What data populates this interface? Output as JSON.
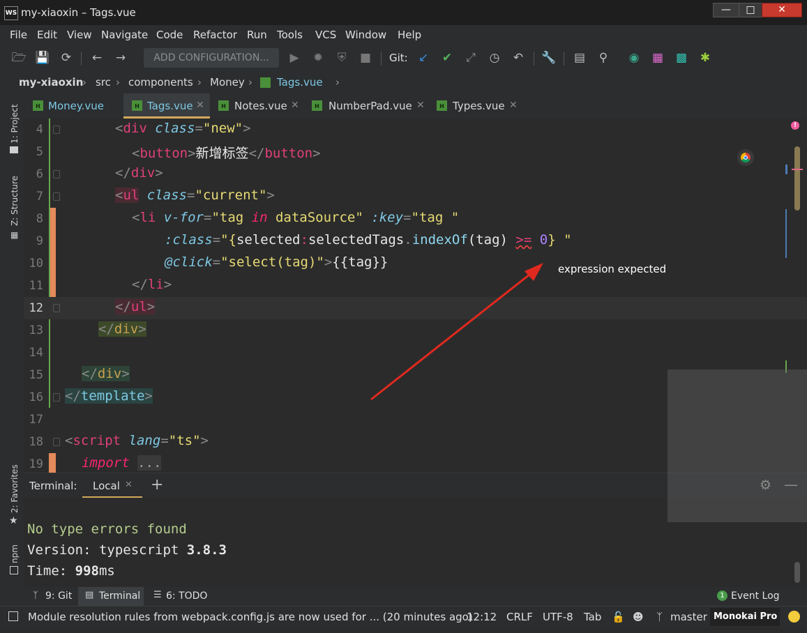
{
  "window": {
    "title": "my-xiaoxin – Tags.vue",
    "app_icon": "WS"
  },
  "menu": [
    "File",
    "Edit",
    "View",
    "Navigate",
    "Code",
    "Refactor",
    "Run",
    "Tools",
    "VCS",
    "Window",
    "Help"
  ],
  "toolbar": {
    "config_label": "ADD CONFIGURATION...",
    "git_label": "Git:"
  },
  "breadcrumb": [
    "my-xiaoxin",
    "src",
    "components",
    "Money",
    "Tags.vue"
  ],
  "left_tools": {
    "project": "1: Project",
    "structure": "Z: Structure",
    "favorites": "2: Favorites",
    "npm": "npm"
  },
  "tabs": [
    {
      "label": "Money.vue"
    },
    {
      "label": "Tags.vue"
    },
    {
      "label": "Notes.vue"
    },
    {
      "label": "NumberPad.vue"
    },
    {
      "label": "Types.vue"
    }
  ],
  "editor": {
    "lines": [
      {
        "num": "4"
      },
      {
        "num": "5"
      },
      {
        "num": "6"
      },
      {
        "num": "7"
      },
      {
        "num": "8"
      },
      {
        "num": "9"
      },
      {
        "num": "10"
      },
      {
        "num": "11"
      },
      {
        "num": "12"
      },
      {
        "num": "13"
      },
      {
        "num": "14"
      },
      {
        "num": "15"
      },
      {
        "num": "16"
      },
      {
        "num": "17"
      },
      {
        "num": "18"
      },
      {
        "num": "19"
      }
    ],
    "code": {
      "l4_tag": "div",
      "l4_attr": "class",
      "l4_val": "\"new\"",
      "l5_tag": "button",
      "l5_text": "新增标签",
      "l6_tag": "div",
      "l7_tag": "ul",
      "l7_attr": "class",
      "l7_val": "\"current\"",
      "l8_tag": "li",
      "l8_dir": "v-for",
      "l8_s1": "\"tag ",
      "l8_kw": "in",
      "l8_s2": " dataSource\"",
      "l8_key": ":key",
      "l8_s3": "\"tag \"",
      "l9_attr": ":class",
      "l9_s1": "\"{",
      "l9_a": "selected",
      "l9_b": "selectedTags",
      "l9_fn": "indexOf",
      "l9_c": "(tag) ",
      "l9_op": ">=",
      "l9_num": "0",
      "l9_s2": "} \"",
      "l10_attr": "@click",
      "l10_s1": "\"",
      "l10_fn": "select",
      "l10_s2": "(tag)\"",
      "l10_text": "{{tag}}",
      "l11_tag": "li",
      "l12_tag": "ul",
      "l13_tag": "div",
      "l15_tag": "div",
      "l16_tag": "template",
      "l18_tag": "script",
      "l18_attr": "lang",
      "l18_val": "\"ts\"",
      "l19_kw": "import",
      "l19_fold": "..."
    },
    "annotation": "expression expected"
  },
  "terminal": {
    "title": "Terminal:",
    "tab": "Local",
    "lines": {
      "l1": "No type errors found",
      "l2_a": "Version: typescript ",
      "l2_b": "3.8.3",
      "l3_a": "Time: ",
      "l3_b": "998",
      "l3_c": "ms"
    }
  },
  "bottom_tools": {
    "git": "9: Git",
    "terminal": "Terminal",
    "todo": "6: TODO",
    "event_log": "Event Log",
    "event_count": "1"
  },
  "status": {
    "message": "Module resolution rules from webpack.config.js are now used for ... (20 minutes ago)",
    "position": "12:12",
    "line_sep": "CRLF",
    "encoding": "UTF-8",
    "indent": "Tab",
    "branch": "master",
    "theme": "Monokai Pro"
  },
  "colors": {
    "accent_tab": "#d4a95a",
    "tag": "#e0407a",
    "string": "#e6db74",
    "attr": "#7ec8e3",
    "close_btn": "#c8392e",
    "arrow": "#e0291e"
  },
  "icons": [
    "open-folder-icon",
    "save-icon",
    "refresh-icon",
    "back-arrow-icon",
    "forward-arrow-icon",
    "run-icon",
    "debug-icon",
    "coverage-icon",
    "stop-icon",
    "git-update-icon",
    "git-commit-icon",
    "git-push-icon",
    "history-icon",
    "rollback-icon",
    "wrench-icon",
    "terminal-icon",
    "search-icon",
    "chrome-icon",
    "error-icon"
  ]
}
